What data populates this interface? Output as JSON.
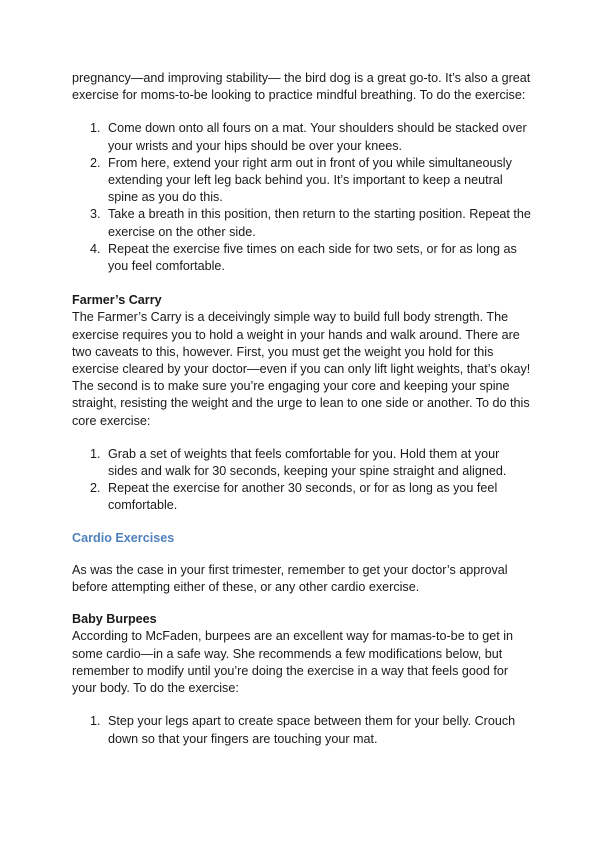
{
  "intro": {
    "text": "pregnancy—and improving stability— the bird dog is a great go-to. It’s also a great exercise for moms-to-be looking to practice mindful breathing. To do the exercise:"
  },
  "bird_dog_steps": [
    {
      "num": "1.",
      "text": "Come down onto all fours on a mat. Your shoulders should be stacked over your wrists and your hips should be over your knees."
    },
    {
      "num": "2.",
      "text": "From here, extend your right arm out in front of you while simultaneously extending your left leg back behind you. It’s important to keep a neutral spine as you do this."
    },
    {
      "num": "3.",
      "text": "Take a breath in this position, then return to the starting position. Repeat the exercise on the other side."
    },
    {
      "num": "4.",
      "text": "Repeat the exercise five times on each side for two sets, or for as long as you feel comfortable."
    }
  ],
  "farmers_carry": {
    "heading": "Farmer’s Carry",
    "text": "The Farmer’s Carry is a deceivingly simple way to build full body strength. The exercise requires you to hold a weight in your hands and walk around. There are two caveats to this, however. First, you must get the weight you hold for this exercise cleared by your doctor—even if you can only lift light weights, that’s okay! The second is to make sure you’re engaging your core and keeping your spine straight, resisting the weight and the urge to lean to one side or another. To do this core exercise:",
    "steps": [
      {
        "num": "1.",
        "text": "Grab a set of weights that feels comfortable for you. Hold them at your sides and walk for 30 seconds, keeping your spine straight and aligned."
      },
      {
        "num": "2.",
        "text": "Repeat the exercise for another 30 seconds, or for as long as you feel comfortable."
      }
    ]
  },
  "cardio": {
    "heading": "Cardio Exercises",
    "text": "As was the case in your first trimester, remember to get your doctor’s approval before attempting either of these, or any other cardio exercise."
  },
  "baby_burpees": {
    "heading": "Baby Burpees",
    "text": "According to McFaden, burpees are an excellent way for mamas-to-be to get in some cardio—in a safe way. She recommends a few modifications below, but remember to modify until you’re doing the exercise in a way that feels good for your body. To do the exercise:",
    "steps": [
      {
        "num": "1.",
        "text": "Step your legs apart to create space between them for your belly. Crouch down so that your fingers are touching your mat."
      }
    ]
  },
  "colors": {
    "heading_accent": "#4f81bd",
    "body_text": "#1a1a1a"
  }
}
